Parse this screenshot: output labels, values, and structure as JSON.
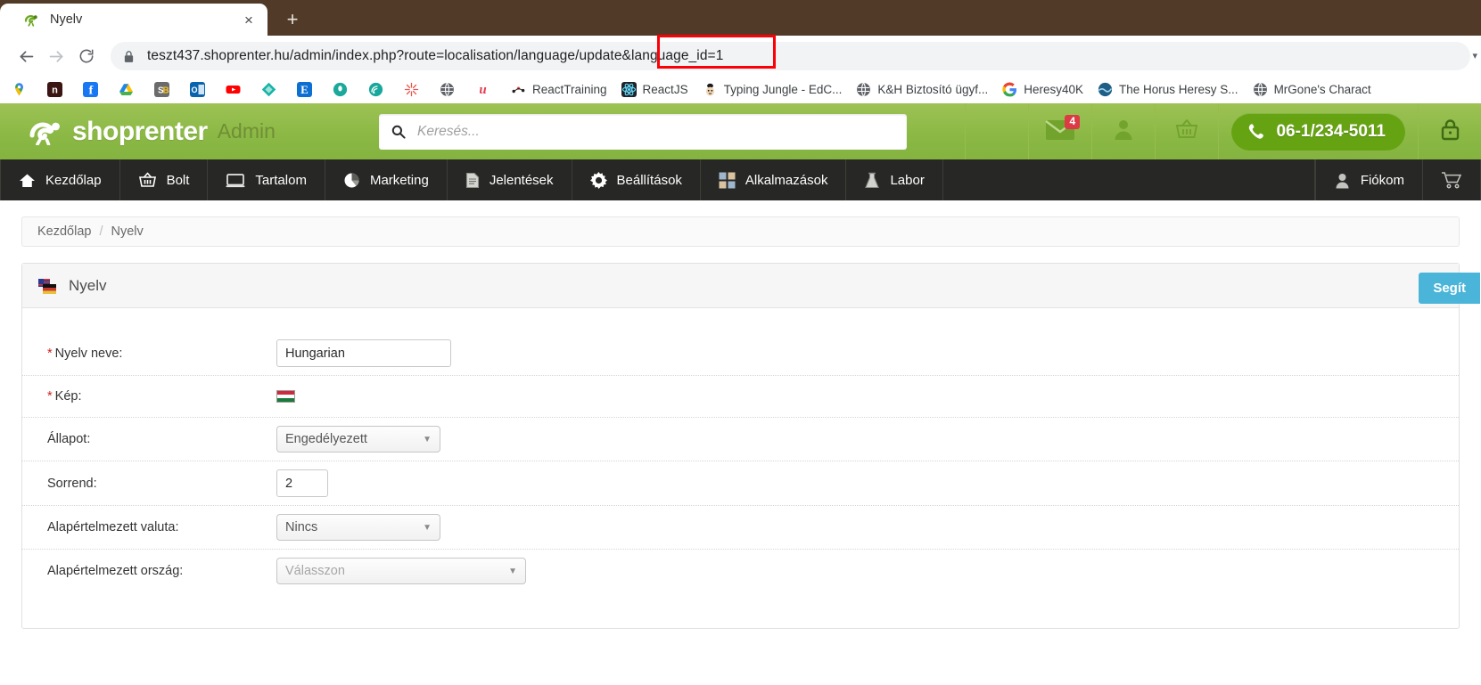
{
  "browser": {
    "tab": {
      "title": "Nyelv",
      "favicon": "shoprenter-favicon",
      "close_label": "×"
    },
    "new_tab_label": "+",
    "nav": {
      "back": "←",
      "forward": "→",
      "reload": "⟳"
    },
    "omnibox": {
      "lock_icon": "lock-icon",
      "url_prefix": "teszt437.shoprenter.hu",
      "url_path": "/admin/index.php?route=localisation/language/update&language_id=1",
      "url_full": "teszt437.shoprenter.hu/admin/index.php?route=localisation/language/update&language_id=1",
      "highlighted_fragment": "&language_id=1",
      "annotation_color": "#fb0007"
    },
    "bookmarks": [
      {
        "label": "",
        "icon": "google-maps-icon",
        "color": "#ffffff"
      },
      {
        "label": "",
        "icon": "nn-dark-icon",
        "color": "#3b1512"
      },
      {
        "label": "",
        "icon": "facebook-icon",
        "color": "#1877f2"
      },
      {
        "label": "",
        "icon": "google-drive-icon",
        "color": "#ffffff"
      },
      {
        "label": "",
        "icon": "sb-icon",
        "color": "#6b6b6b"
      },
      {
        "label": "",
        "icon": "outlook-icon",
        "color": "#0a63ad"
      },
      {
        "label": "",
        "icon": "youtube-icon",
        "color": "#ff0000"
      },
      {
        "label": "",
        "icon": "diamond-teal-icon",
        "color": "#19b3a6"
      },
      {
        "label": "",
        "icon": "etsy-e-icon",
        "color": "#0d6fd1"
      },
      {
        "label": "",
        "icon": "teal-circle-icon",
        "color": "#1aa99a"
      },
      {
        "label": "",
        "icon": "wifi-teal-icon",
        "color": "#18a89b"
      },
      {
        "label": "",
        "icon": "sparkle-red-icon",
        "color": "#e8574f"
      },
      {
        "label": "",
        "icon": "globe-gray-icon",
        "color": "#5f6368"
      },
      {
        "label": "",
        "icon": "u-red-icon",
        "color": "#e63b4c"
      },
      {
        "label": "ReactTraining",
        "icon": "react-training-icon",
        "color": "#ffffff"
      },
      {
        "label": "ReactJS",
        "icon": "reactjs-icon",
        "color": "#20232a"
      },
      {
        "label": "Typing Jungle - EdC...",
        "icon": "typing-jungle-icon",
        "color": "#f2d7b6"
      },
      {
        "label": "K&H Biztosító ügyf...",
        "icon": "globe-gray-icon",
        "color": "#5f6368"
      },
      {
        "label": "Heresy40K",
        "icon": "google-g-icon",
        "color": "#ffffff"
      },
      {
        "label": "The Horus Heresy S...",
        "icon": "horus-heresy-icon",
        "color": "#1f5f86"
      },
      {
        "label": "MrGone's Charact",
        "icon": "globe-gray-icon",
        "color": "#5f6368"
      }
    ]
  },
  "app": {
    "brand": {
      "logo_text": "shoprenter",
      "logo_suffix": "Admin",
      "logo_icon": "shoprenter-snail-icon"
    },
    "search": {
      "placeholder": "Keresés...",
      "value": "",
      "icon": "search-icon"
    },
    "header_actions": [
      {
        "name": "messages",
        "icon": "envelope-icon",
        "badge": "4"
      },
      {
        "name": "account",
        "icon": "user-icon",
        "badge": ""
      },
      {
        "name": "cart",
        "icon": "basket-icon",
        "badge": ""
      }
    ],
    "phone": {
      "number": "06-1/234-5011",
      "icon": "phone-icon"
    },
    "lock": {
      "icon": "padlock-icon"
    },
    "nav": [
      {
        "label": "Kezdőlap",
        "icon": "home-icon"
      },
      {
        "label": "Bolt",
        "icon": "basket-icon"
      },
      {
        "label": "Tartalom",
        "icon": "monitor-icon"
      },
      {
        "label": "Marketing",
        "icon": "pie-chart-icon"
      },
      {
        "label": "Jelentések",
        "icon": "document-icon"
      },
      {
        "label": "Beállítások",
        "icon": "gear-icon"
      },
      {
        "label": "Alkalmazások",
        "icon": "grid-icon"
      },
      {
        "label": "Labor",
        "icon": "flask-icon"
      }
    ],
    "nav_right": [
      {
        "label": "Fiókom",
        "icon": "user-icon"
      },
      {
        "label": "",
        "icon": "shopping-cart-icon"
      }
    ],
    "breadcrumb": {
      "home": "Kezdőlap",
      "separator": "/",
      "current": "Nyelv"
    },
    "panel": {
      "title": "Nyelv",
      "icon": "flags-icon",
      "help_button": "Segít",
      "help_color": "#4ab5d8"
    },
    "form": {
      "rows": [
        {
          "label": "Nyelv neve:",
          "required": true,
          "control": "text",
          "value": "Hungarian",
          "name": "language-name-input"
        },
        {
          "label": "Kép:",
          "required": true,
          "control": "flag",
          "value": "hu-flag",
          "name": "language-image"
        },
        {
          "label": "Állapot:",
          "required": false,
          "control": "select",
          "value": "Engedélyezett",
          "name": "status-select"
        },
        {
          "label": "Sorrend:",
          "required": false,
          "control": "text",
          "value": "2",
          "name": "sort-order-input"
        },
        {
          "label": "Alapértelmezett valuta:",
          "required": false,
          "control": "select",
          "value": "Nincs",
          "name": "default-currency-select"
        },
        {
          "label": "Alapértelmezett ország:",
          "required": false,
          "control": "select",
          "value": "Válasszon",
          "name": "default-country-select",
          "muted": true
        }
      ]
    }
  }
}
